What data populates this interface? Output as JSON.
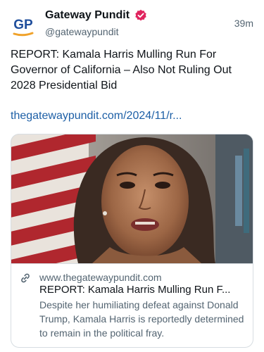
{
  "account": {
    "avatar_text": "GP",
    "display_name": "Gateway Pundit",
    "handle": "@gatewaypundit",
    "time": "39m"
  },
  "post": {
    "text": "REPORT: Kamala Harris Mulling Run For Governor of California – Also Not Ruling Out 2028 Presidential Bid",
    "link_text": "thegatewaypundit.com/2024/11/r..."
  },
  "card": {
    "domain": "www.thegatewaypundit.com",
    "title": "REPORT: Kamala Harris Mulling Run F...",
    "description": "Despite her humiliating defeat against Donald Trump, Kamala Harris is reportedly determined to remain in the political fray."
  },
  "colors": {
    "link": "#1d5fa6",
    "secondary_text": "#536471",
    "verified_badge": "#e0245e",
    "avatar_blue": "#1f4e9c",
    "avatar_underline": "#f0a22a"
  },
  "icons": {
    "verified": "verified-badge-icon",
    "link": "link-icon"
  }
}
